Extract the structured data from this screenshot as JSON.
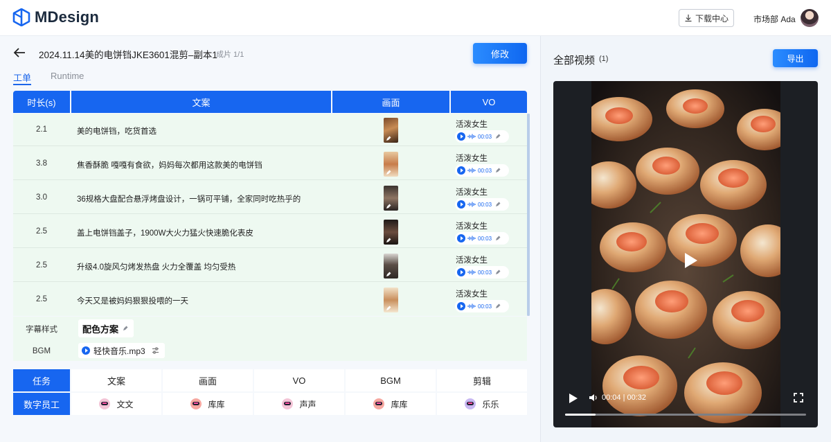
{
  "app": {
    "brand": "MDesign"
  },
  "header": {
    "download_label": "下载中心",
    "user_label": "市场部 Ada"
  },
  "doc": {
    "title": "2024.11.14美的电饼铛JKE3601混剪–副本1",
    "subtitle": "成片 1/1",
    "edit_label": "修改"
  },
  "tabs": [
    {
      "label": "工单",
      "active": true
    },
    {
      "label": "Runtime",
      "active": false
    }
  ],
  "script_table": {
    "headers": [
      "时长(s)",
      "文案",
      "画面",
      "VO"
    ],
    "rows": [
      {
        "duration": "2.1",
        "text": "美的电饼铛，吃货首选",
        "vo_voice": "活泼女生",
        "vo_time": "00:03"
      },
      {
        "duration": "3.8",
        "text": "焦香酥脆 嘎嘎有食欲，妈妈每次都用这款美的电饼铛",
        "vo_voice": "活泼女生",
        "vo_time": "00:03"
      },
      {
        "duration": "3.0",
        "text": "36规格大盘配合悬浮烤盘设计，一锅可平铺，全家同时吃热乎的",
        "vo_voice": "活泼女生",
        "vo_time": "00:03"
      },
      {
        "duration": "2.5",
        "text": "盖上电饼铛盖子，1900W大火力猛火快速脆化表皮",
        "vo_voice": "活泼女生",
        "vo_time": "00:03"
      },
      {
        "duration": "2.5",
        "text": "升级4.0旋风匀烤发热盘 火力全覆盖 均匀受热",
        "vo_voice": "活泼女生",
        "vo_time": "00:03"
      },
      {
        "duration": "2.5",
        "text": "今天又是被妈妈狠狠投喂的一天",
        "vo_voice": "活泼女生",
        "vo_time": "00:03"
      }
    ]
  },
  "extras": {
    "subtitle_style_label": "字幕样式",
    "subtitle_style_value": "配色方案",
    "bgm_label": "BGM",
    "bgm_value": "轻快音乐.mp3"
  },
  "task_table": {
    "headers": [
      "任务",
      "文案",
      "画面",
      "VO",
      "BGM",
      "剪辑"
    ],
    "row_label": "数字员工",
    "agents": [
      "文文",
      "库库",
      "声声",
      "库库",
      "乐乐"
    ]
  },
  "right_panel": {
    "title": "全部视频",
    "count": "(1)",
    "export_label": "导出"
  },
  "video": {
    "time_display": "00:04 | 00:32",
    "progress": 0.125
  },
  "colors": {
    "accent": "#1766f0",
    "row_bg": "#eef9f1"
  },
  "icons": [
    "back-arrow-icon",
    "download-icon",
    "pen-icon",
    "play-icon",
    "audio-wave-icon",
    "adjust-icon",
    "volume-icon",
    "fullscreen-icon",
    "robot-avatar-icon"
  ]
}
